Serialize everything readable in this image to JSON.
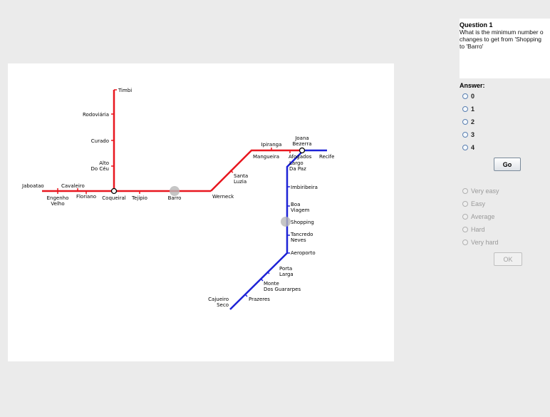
{
  "question": {
    "title": "Question 1",
    "text": "What is the minimum number o\nchanges to get from 'Shopping\nto 'Barro'"
  },
  "answer": {
    "title": "Answer:",
    "options": [
      "0",
      "1",
      "2",
      "3",
      "4"
    ],
    "go_label": "Go"
  },
  "rating": {
    "options": [
      "Very easy",
      "Easy",
      "Average",
      "Hard",
      "Very hard"
    ],
    "ok_label": "OK"
  },
  "map": {
    "line_colors": {
      "red": "#e8171f",
      "blue": "#1d22d6"
    },
    "stations": {
      "timbi": "Timbi",
      "rodoviaria": "Rodoviária",
      "curado": "Curado",
      "alto_do_ceu": [
        "Alto",
        "Do Céu"
      ],
      "jaboatao": "Jaboatao",
      "cavaleiro": "Cavaleiro",
      "engenho_velho": [
        "Engenho",
        "Velho"
      ],
      "floriano": "Floriano",
      "coqueiral": "Coqueiral",
      "tejipio": "Tejipio",
      "barro": "Barro",
      "werneck": "Werneck",
      "santa_luzia": [
        "Santa",
        "Luzia"
      ],
      "mangueira": "Mangueira",
      "ipiranga": "Ipiranga",
      "joana_bezerra": [
        "Joana",
        "Bezerra"
      ],
      "afogados": "Afogados",
      "recife": "Recife",
      "largo_da_paz": [
        "Largo",
        "Da Paz"
      ],
      "imbiribeira": "Imbiribeira",
      "boa_viagem": [
        "Boa",
        "Viagem"
      ],
      "shopping": "Shopping",
      "tancredo_neves": [
        "Tancredo",
        "Neves"
      ],
      "aeroporto": "Aeroporto",
      "porta_larga": [
        "Porta",
        "Larga"
      ],
      "monte_dos_guararapes": [
        "Monte",
        "Dos Guararpes"
      ],
      "prazeres": "Prazeres",
      "cajueiro_seco": [
        "Cajueiro",
        "Seco"
      ]
    }
  }
}
